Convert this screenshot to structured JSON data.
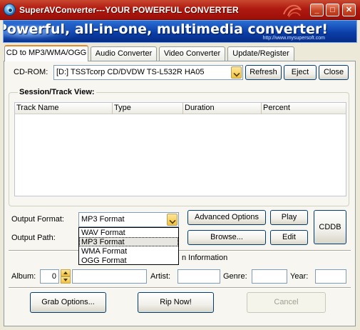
{
  "window": {
    "title": "SuperAVConverter---YOUR POWERFUL CONVERTER",
    "minimize_label": "_",
    "maximize_label": "□",
    "close_label": "✕"
  },
  "banner": {
    "headline": "Powerful, all-in-one, multimedia converter!",
    "url": "http://www.mysupersoft.com"
  },
  "tabs": [
    {
      "label": "CD to MP3/WMA/OGG",
      "active": true
    },
    {
      "label": "Audio Converter",
      "active": false
    },
    {
      "label": "Video Converter",
      "active": false
    },
    {
      "label": "Update/Register",
      "active": false
    }
  ],
  "cdrom": {
    "label": "CD-ROM:",
    "selected": "[D:] TSSTcorp CD/DVDW TS-L532R HA05",
    "refresh_label": "Refresh",
    "eject_label": "Eject",
    "close_label": "Close"
  },
  "session": {
    "title": "Session/Track View:",
    "columns": [
      "Track Name",
      "Type",
      "Duration",
      "Percent"
    ],
    "rows": []
  },
  "output": {
    "format_label": "Output Format:",
    "format_selected": "MP3 Format",
    "format_options": [
      "WAV Format",
      "MP3 Format",
      "WMA Format",
      "OGG Format"
    ],
    "highlighted_option": "MP3 Format",
    "path_label": "Output Path:",
    "advanced_label": "Advanced Options",
    "browse_label": "Browse...",
    "play_label": "Play",
    "edit_label": "Edit",
    "cddb_label": "CDDB"
  },
  "info": {
    "section_title_visible": "n Information",
    "album_label": "Album:",
    "album_number": "0",
    "album_name": "",
    "artist_label": "Artist:",
    "artist_value": "",
    "genre_label": "Genre:",
    "genre_value": "",
    "year_label": "Year:",
    "year_value": ""
  },
  "actions": {
    "grab_options_label": "Grab Options...",
    "rip_now_label": "Rip Now!",
    "cancel_label": "Cancel"
  },
  "colors": {
    "titlebar": "#b01a10",
    "banner": "#0b3ea8",
    "accent_tab": "#e68b2c"
  }
}
